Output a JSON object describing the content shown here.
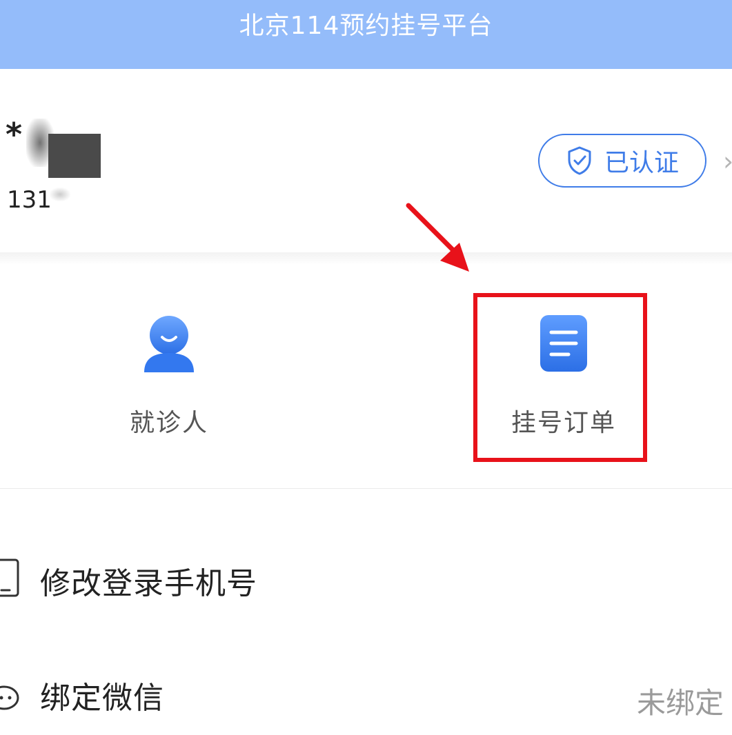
{
  "header": {
    "title": "北京114预约挂号平台"
  },
  "profile": {
    "name_visible": "*",
    "phone_visible": "131",
    "verified_label": "已认证"
  },
  "grid": {
    "items": [
      {
        "label": "就诊人",
        "icon": "person-icon"
      },
      {
        "label": "挂号订单",
        "icon": "document-icon"
      }
    ]
  },
  "menu": {
    "items": [
      {
        "label": "修改登录手机号",
        "icon": "phone-icon",
        "value": ""
      },
      {
        "label": "绑定微信",
        "icon": "wechat-icon",
        "value": "未绑定"
      }
    ]
  },
  "colors": {
    "header_bg": "#94bcfa",
    "accent": "#3f7ce8",
    "highlight": "#e8121a"
  }
}
